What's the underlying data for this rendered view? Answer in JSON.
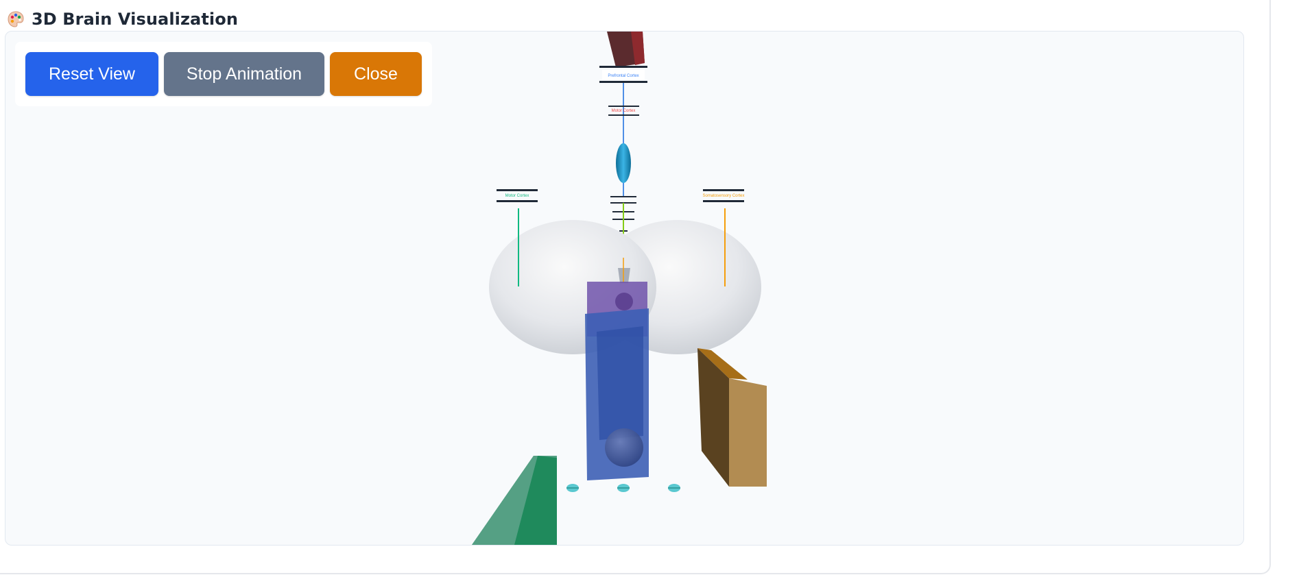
{
  "header": {
    "title": "3D Brain Visualization",
    "icon": "palette-icon"
  },
  "controls": {
    "reset_label": "Reset View",
    "stop_label": "Stop Animation",
    "close_label": "Close"
  },
  "colors": {
    "reset": "#2563eb",
    "stop": "#64748b",
    "close": "#d97706",
    "viewport_bg": "#f8fafc"
  },
  "scene_labels": {
    "prefrontal": "Prefrontal Cortex",
    "upper_small": "Motor Cortex",
    "left_small": "Motor Cortex",
    "right_small": "Somatosensory Cortex"
  }
}
